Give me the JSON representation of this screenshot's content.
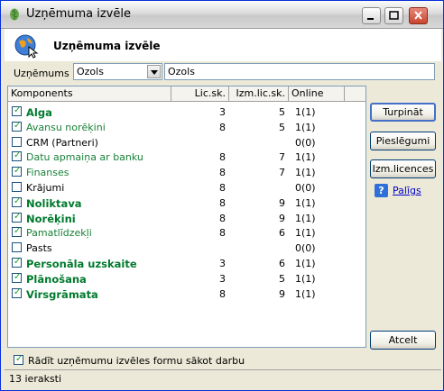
{
  "window": {
    "title": "Uzņēmuma izvēle",
    "icon": "leaf-icon"
  },
  "header": {
    "title": "Uzņēmuma izvēle",
    "icon": "globe-cursor-icon"
  },
  "company": {
    "label": "Uzņēmums",
    "code": "Ozols",
    "name": "Ozols"
  },
  "grid": {
    "columns": [
      "Komponents",
      "Lic.sk.",
      "Izm.lic.sk.",
      "Online"
    ],
    "rows": [
      {
        "name": "Alga",
        "checked": true,
        "style": "bold",
        "lic": "3",
        "izm": "5",
        "online": "1(1)"
      },
      {
        "name": "Avansu norēķini",
        "checked": true,
        "style": "green",
        "lic": "8",
        "izm": "5",
        "online": "1(1)"
      },
      {
        "name": "CRM (Partneri)",
        "checked": false,
        "style": "plain",
        "lic": "",
        "izm": "",
        "online": "0(0)"
      },
      {
        "name": "Datu apmaiņa ar banku",
        "checked": true,
        "style": "green",
        "lic": "8",
        "izm": "7",
        "online": "1(1)"
      },
      {
        "name": "Finanses",
        "checked": true,
        "style": "green",
        "lic": "8",
        "izm": "7",
        "online": "1(1)"
      },
      {
        "name": "Krājumi",
        "checked": false,
        "style": "plain",
        "lic": "8",
        "izm": "",
        "online": "0(0)"
      },
      {
        "name": "Noliktava",
        "checked": true,
        "style": "bold",
        "lic": "8",
        "izm": "9",
        "online": "1(1)"
      },
      {
        "name": "Norēķini",
        "checked": true,
        "style": "bold",
        "lic": "8",
        "izm": "9",
        "online": "1(1)"
      },
      {
        "name": "Pamatlīdzekļi",
        "checked": true,
        "style": "green",
        "lic": "8",
        "izm": "6",
        "online": "1(1)"
      },
      {
        "name": "Pasts",
        "checked": false,
        "style": "plain",
        "lic": "",
        "izm": "",
        "online": "0(0)"
      },
      {
        "name": "Personāla uzskaite",
        "checked": true,
        "style": "bold",
        "lic": "3",
        "izm": "6",
        "online": "1(1)"
      },
      {
        "name": "Plānošana",
        "checked": true,
        "style": "bold",
        "lic": "3",
        "izm": "5",
        "online": "1(1)"
      },
      {
        "name": "Virsgrāmata",
        "checked": true,
        "style": "bold",
        "lic": "8",
        "izm": "9",
        "online": "1(1)"
      }
    ]
  },
  "buttons": {
    "continue": "Turpināt",
    "connections": "Pieslēgumi",
    "licences": "Izm.licences",
    "help": "Palīgs",
    "cancel": "Atcelt"
  },
  "footer": {
    "show_on_start_label": "Rādīt uzņēmumu izvēles formu sākot darbu",
    "show_on_start_checked": true
  },
  "status": {
    "text": "13 ieraksti"
  }
}
